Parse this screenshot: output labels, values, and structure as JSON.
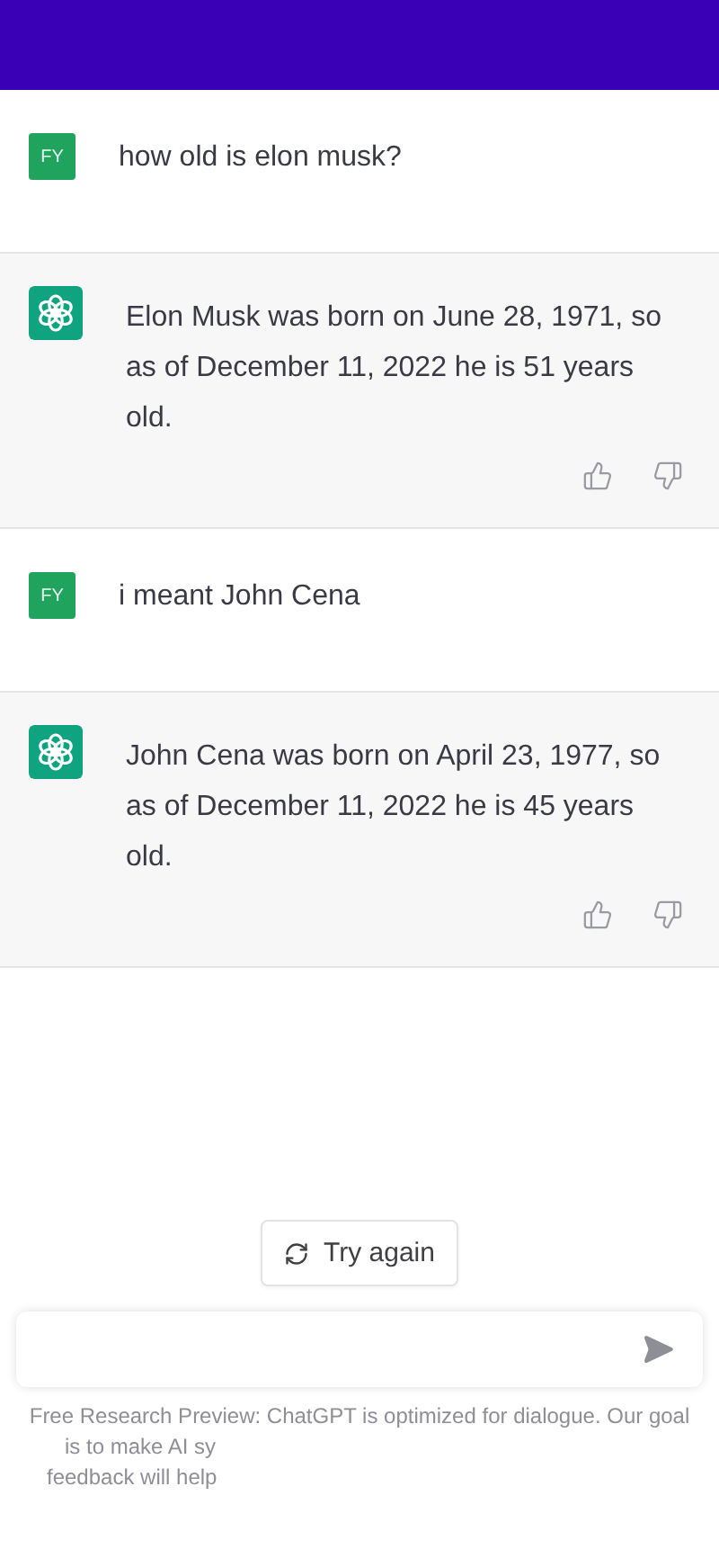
{
  "messages": [
    {
      "kind": "user",
      "avatar": "FY",
      "text": "how old is elon musk?"
    },
    {
      "kind": "assistant",
      "text": "Elon Musk was born on June 28, 1971, so as of December 11, 2022 he is 51 years old."
    },
    {
      "kind": "user",
      "avatar": "FY",
      "text": "i meant John Cena"
    },
    {
      "kind": "assistant",
      "text": "John Cena was born on April 23, 1977, so as of December 11, 2022 he is 45 years old."
    }
  ],
  "retry_button": {
    "label": "Try again"
  },
  "footer_lines": [
    "Free Research Preview: ChatGPT is optimized for dialogue. Our goal",
    "is to make AI sy",
    "feedback will help"
  ]
}
